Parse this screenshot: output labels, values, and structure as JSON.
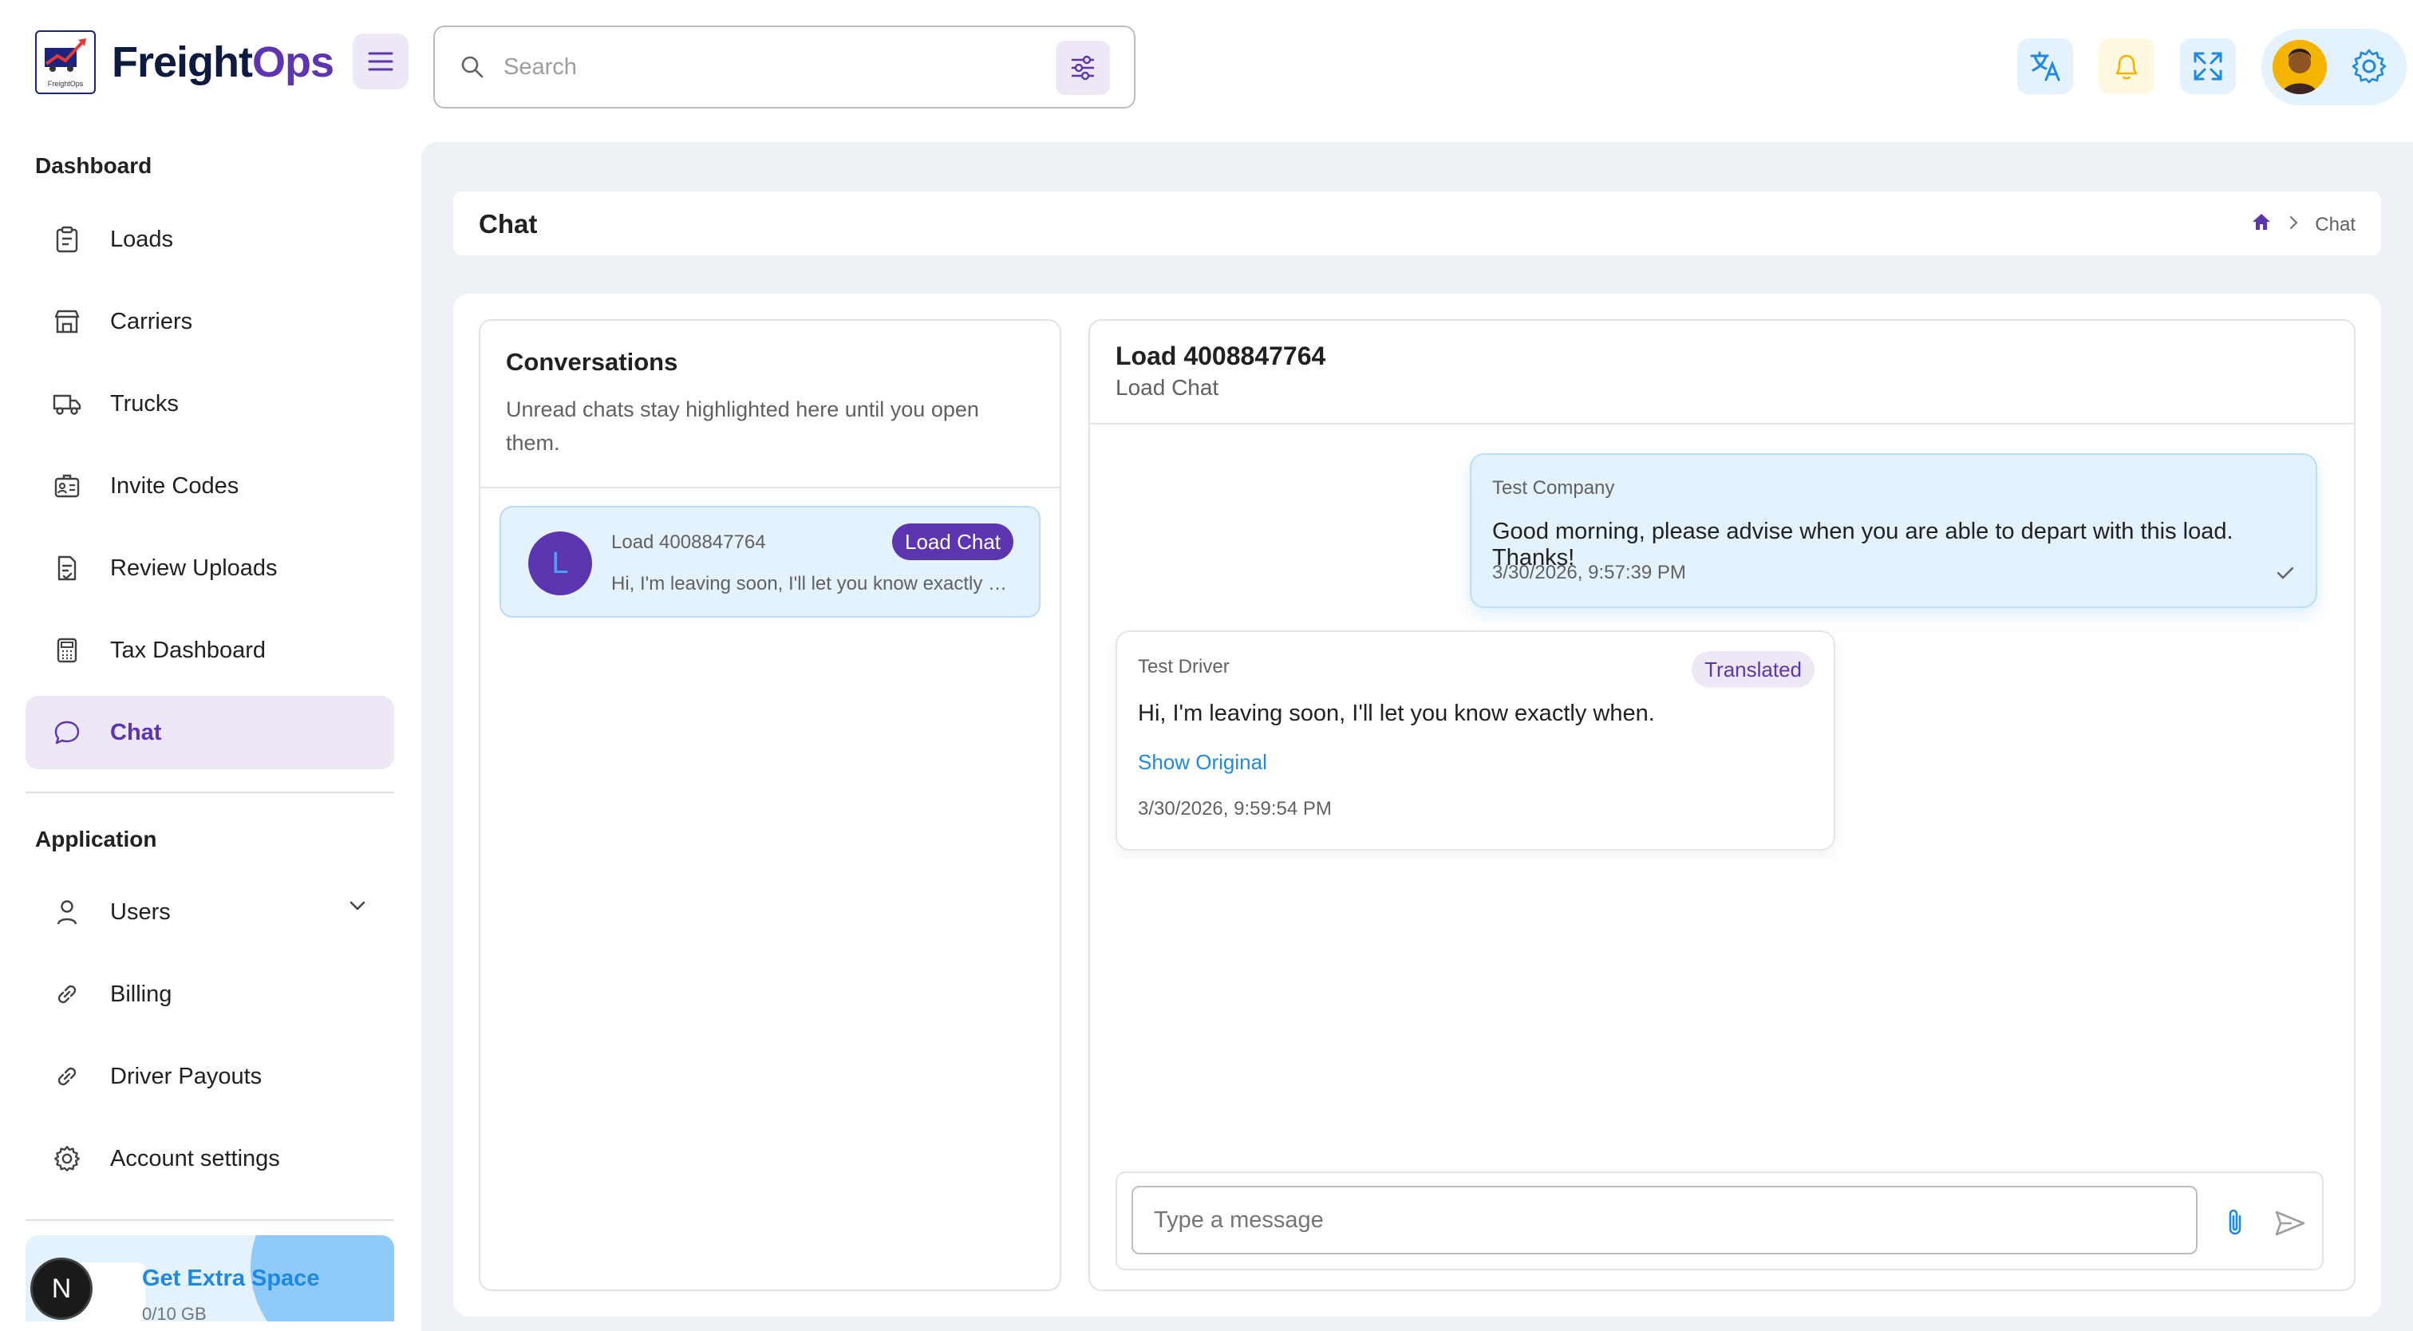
{
  "brand": {
    "name_part1": "Freight",
    "name_part2": "Ops",
    "mini_text": "FreightOps"
  },
  "search": {
    "placeholder": "Search"
  },
  "colors": {
    "accent": "#5e35b1",
    "accent_light": "#ede7f6",
    "blue": "#1e88e5",
    "blue_light": "#e3f2fd",
    "warning_light": "#fff8e1"
  },
  "header_icons": [
    "menu-icon",
    "search-icon",
    "filter-icon",
    "translate-icon",
    "bell-icon",
    "fullscreen-icon",
    "avatar",
    "gear-icon"
  ],
  "sidebar": {
    "dashboard_title": "Dashboard",
    "dashboard_items": [
      {
        "label": "Loads",
        "icon": "clipboard-icon"
      },
      {
        "label": "Carriers",
        "icon": "building-icon"
      },
      {
        "label": "Trucks",
        "icon": "truck-icon"
      },
      {
        "label": "Invite Codes",
        "icon": "id-card-icon"
      },
      {
        "label": "Review Uploads",
        "icon": "file-check-icon"
      },
      {
        "label": "Tax Dashboard",
        "icon": "calculator-icon"
      },
      {
        "label": "Chat",
        "icon": "chat-bubble-icon",
        "active": true
      }
    ],
    "application_title": "Application",
    "application_items": [
      {
        "label": "Users",
        "icon": "user-icon"
      },
      {
        "label": "Billing",
        "icon": "link-icon"
      },
      {
        "label": "Driver Payouts",
        "icon": "link-icon"
      },
      {
        "label": "Account settings",
        "icon": "gear-icon"
      }
    ],
    "extra_space": {
      "title": "Get Extra Space",
      "usage": "0/10 GB"
    },
    "floating_badge": "N"
  },
  "page": {
    "title": "Chat",
    "breadcrumb": [
      "home",
      "Chat"
    ]
  },
  "conversations": {
    "title": "Conversations",
    "subtitle": "Unread chats stay highlighted here until you open them.",
    "items": [
      {
        "avatar_letter": "L",
        "name": "Load 4008847764",
        "tag": "Load Chat",
        "preview": "Hi, I'm leaving soon, I'll let you know exactly when."
      }
    ]
  },
  "chat": {
    "title": "Load 4008847764",
    "subtitle": "Load Chat",
    "messages": [
      {
        "direction": "outgoing",
        "sender": "Test Company",
        "body": "Good morning, please advise when you are able to depart with this load. Thanks!",
        "time": "3/30/2026, 9:57:39 PM",
        "status": "delivered"
      },
      {
        "direction": "incoming",
        "sender": "Test Driver",
        "badge": "Translated",
        "body": "Hi, I'm leaving soon, I'll let you know exactly when.",
        "action": "Show Original",
        "time": "3/30/2026, 9:59:54 PM"
      }
    ],
    "composer_placeholder": "Type a message"
  }
}
